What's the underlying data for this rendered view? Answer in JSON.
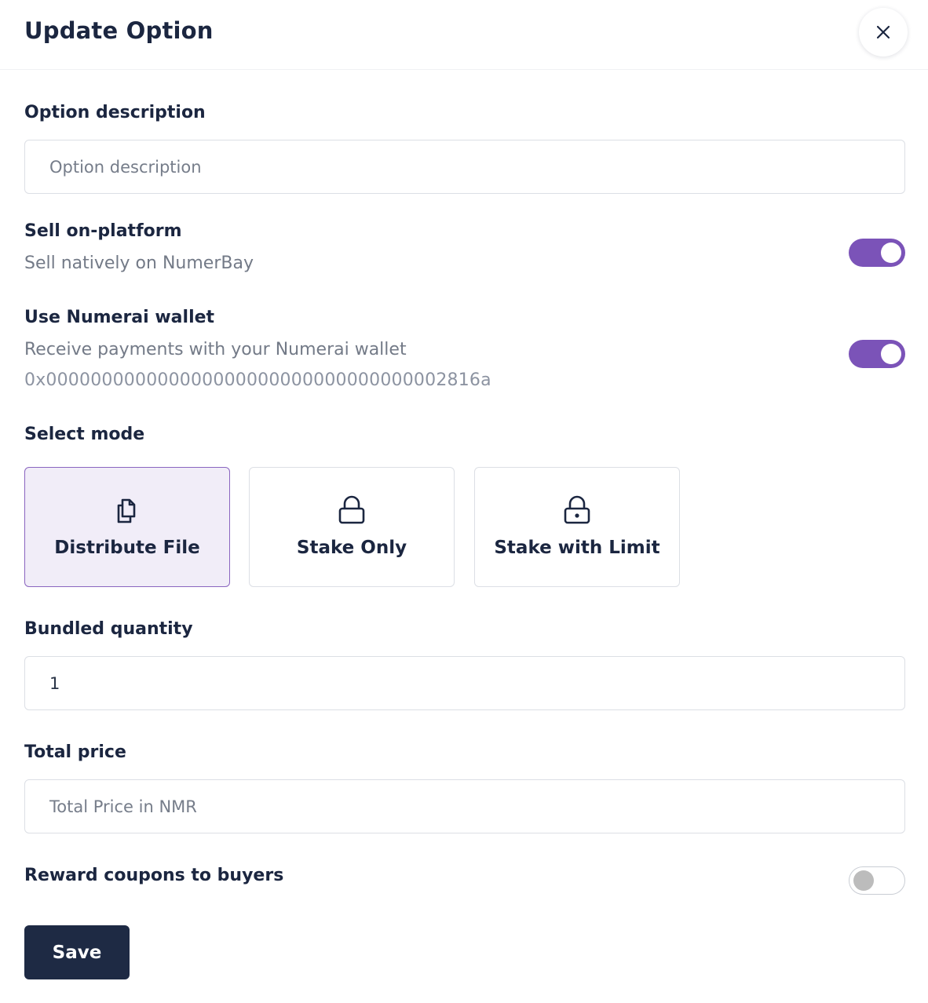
{
  "modal": {
    "title": "Update Option",
    "close_icon": "close-icon"
  },
  "description": {
    "label": "Option description",
    "placeholder": "Option description",
    "value": ""
  },
  "sell_on_platform": {
    "label": "Sell on-platform",
    "description": "Sell natively on NumerBay",
    "enabled": true
  },
  "numerai_wallet": {
    "label": "Use Numerai wallet",
    "description": "Receive payments with your Numerai wallet",
    "address": "0x000000000000000000000000000000000002816a",
    "enabled": true
  },
  "mode": {
    "label": "Select mode",
    "options": [
      {
        "label": "Distribute File",
        "icon": "files-icon",
        "selected": true
      },
      {
        "label": "Stake Only",
        "icon": "lock-icon",
        "selected": false
      },
      {
        "label": "Stake with Limit",
        "icon": "lock-keyhole-icon",
        "selected": false
      }
    ]
  },
  "bundled_quantity": {
    "label": "Bundled quantity",
    "value": "1"
  },
  "total_price": {
    "label": "Total price",
    "placeholder": "Total Price in NMR",
    "value": ""
  },
  "reward_coupons": {
    "label": "Reward coupons to buyers",
    "enabled": false
  },
  "actions": {
    "save_label": "Save"
  },
  "colors": {
    "accent": "#7b53b8",
    "primary_button": "#1e2a44",
    "selected_bg": "#f1edf8"
  }
}
